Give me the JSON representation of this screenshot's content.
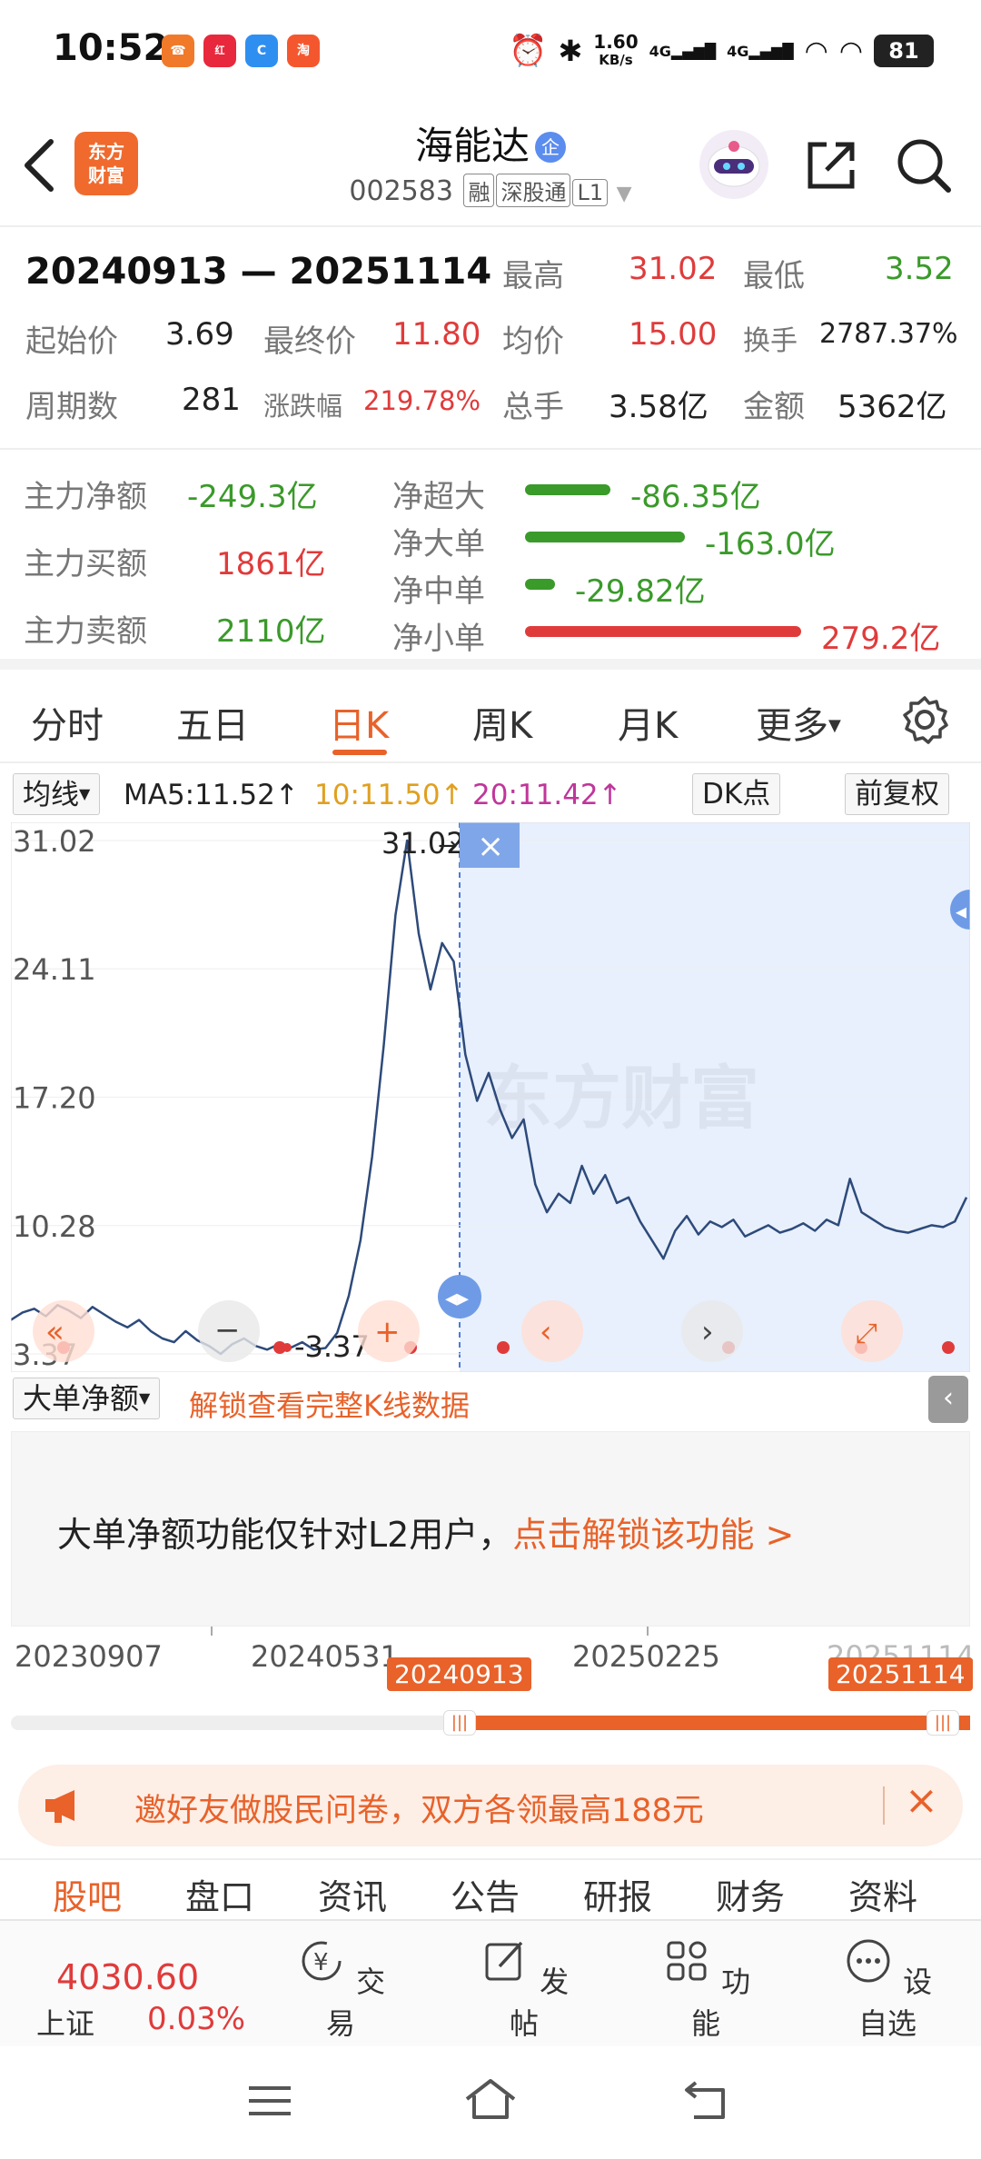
{
  "status_bar": {
    "time": "10:52",
    "net_speed_value": "1.60",
    "net_speed_unit": "KB/s",
    "net1": "4G",
    "net2": "4G",
    "battery": "81"
  },
  "header": {
    "logo_text_line1": "东方",
    "logo_text_line2": "财富",
    "stock_name": "海能达",
    "badge": "企",
    "stock_code": "002583",
    "tags": [
      "融",
      "深股通",
      "L1"
    ]
  },
  "summary": {
    "range_start": "20240913",
    "range_sep": "—",
    "range_end": "20251114",
    "high_label": "最高",
    "high": "31.02",
    "low_label": "最低",
    "low": "3.52",
    "start_price_label": "起始价",
    "start_price": "3.69",
    "end_price_label": "最终价",
    "end_price": "11.80",
    "avg_price_label": "均价",
    "avg_price": "15.00",
    "turnover_label": "换手",
    "turnover": "2787.37%",
    "periods_label": "周期数",
    "periods": "281",
    "change_label": "涨跌幅",
    "change": "219.78%",
    "total_vol_label": "总手",
    "total_vol": "3.58亿",
    "amount_label": "金额",
    "amount": "5362亿"
  },
  "flow": {
    "main_net_label": "主力净额",
    "main_net": "-249.3亿",
    "main_buy_label": "主力买额",
    "main_buy": "1861亿",
    "main_sell_label": "主力卖额",
    "main_sell": "2110亿",
    "rows": [
      {
        "label": "净超大",
        "value": "-86.35亿",
        "ratio": 0.31,
        "color": "#3a9a2a"
      },
      {
        "label": "净大单",
        "value": "-163.0亿",
        "ratio": 0.58,
        "color": "#3a9a2a"
      },
      {
        "label": "净中单",
        "value": "-29.82亿",
        "ratio": 0.11,
        "color": "#3a9a2a"
      },
      {
        "label": "净小单",
        "value": "279.2亿",
        "ratio": 1.0,
        "color": "#e03b3b"
      }
    ]
  },
  "tabs": [
    "分时",
    "五日",
    "日K",
    "周K",
    "月K",
    "更多"
  ],
  "ma": {
    "selector": "均线",
    "ma5": "MA5:11.52",
    "ma10": "10:11.50",
    "ma20": "20:11.42",
    "dk_button": "DK点",
    "adjust_button": "前复权"
  },
  "chart": {
    "y_labels": [
      "31.02",
      "24.11",
      "17.20",
      "10.28",
      "3.37"
    ],
    "max_label": "31.02",
    "min_label": "3.37",
    "watermark": "东方财富"
  },
  "chart_data": {
    "type": "line",
    "title": "",
    "xlabel": "",
    "ylabel": "",
    "x": [
      "20230907",
      "20240531",
      "20250225",
      "20251114"
    ],
    "ylim": [
      3.37,
      31.02
    ],
    "y_ticks": [
      31.02,
      24.11,
      17.2,
      10.28,
      3.37
    ],
    "selected_range": [
      "20240913",
      "20251114"
    ],
    "series": [
      {
        "values": [
          5.2,
          5.6,
          5.8,
          5.4,
          6.0,
          5.7,
          5.3,
          5.9,
          5.5,
          5.1,
          4.8,
          5.2,
          4.6,
          4.2,
          4.0,
          4.6,
          4.1,
          3.8,
          3.37,
          3.9,
          4.2,
          3.8,
          3.6,
          3.9,
          3.7,
          4.0,
          3.6,
          3.69,
          4.5,
          6.5,
          9.5,
          14.0,
          20.0,
          27.0,
          31.02,
          26.0,
          23.0,
          25.5,
          24.5,
          19.5,
          17.0,
          18.5,
          16.5,
          15.0,
          16.0,
          12.5,
          11.0,
          12.0,
          11.5,
          13.5,
          12.0,
          13.0,
          11.5,
          11.8,
          10.5,
          9.5,
          8.5,
          10.0,
          10.8,
          9.8,
          10.5,
          10.2,
          10.6,
          9.7,
          10.0,
          10.3,
          9.9,
          10.1,
          10.4,
          10.0,
          10.6,
          10.3,
          12.8,
          11.0,
          10.6,
          10.2,
          10.0,
          9.9,
          10.1,
          10.3,
          10.2,
          10.5,
          11.8
        ]
      }
    ]
  },
  "l2": {
    "selector": "大单净额",
    "unlock_link": "解锁查看完整K线数据",
    "notice": "大单净额功能仅针对L2用户，",
    "notice_link": "点击解锁该功能 >"
  },
  "timeline": {
    "dates": [
      "20230907",
      "20240531",
      "20250225",
      "20251114"
    ],
    "sel_start": "20240913",
    "sel_end": "20251114"
  },
  "invite": {
    "text": "邀好友做股民问卷，双方各领最高188元"
  },
  "subtabs": [
    "股吧",
    "盘口",
    "资讯",
    "公告",
    "研报",
    "财务",
    "资料"
  ],
  "bottom_nav": {
    "index_value": "4030.60",
    "index_name": "上证",
    "index_change": "0.03%",
    "items": [
      "交易",
      "发帖",
      "功能",
      "设自选"
    ]
  }
}
